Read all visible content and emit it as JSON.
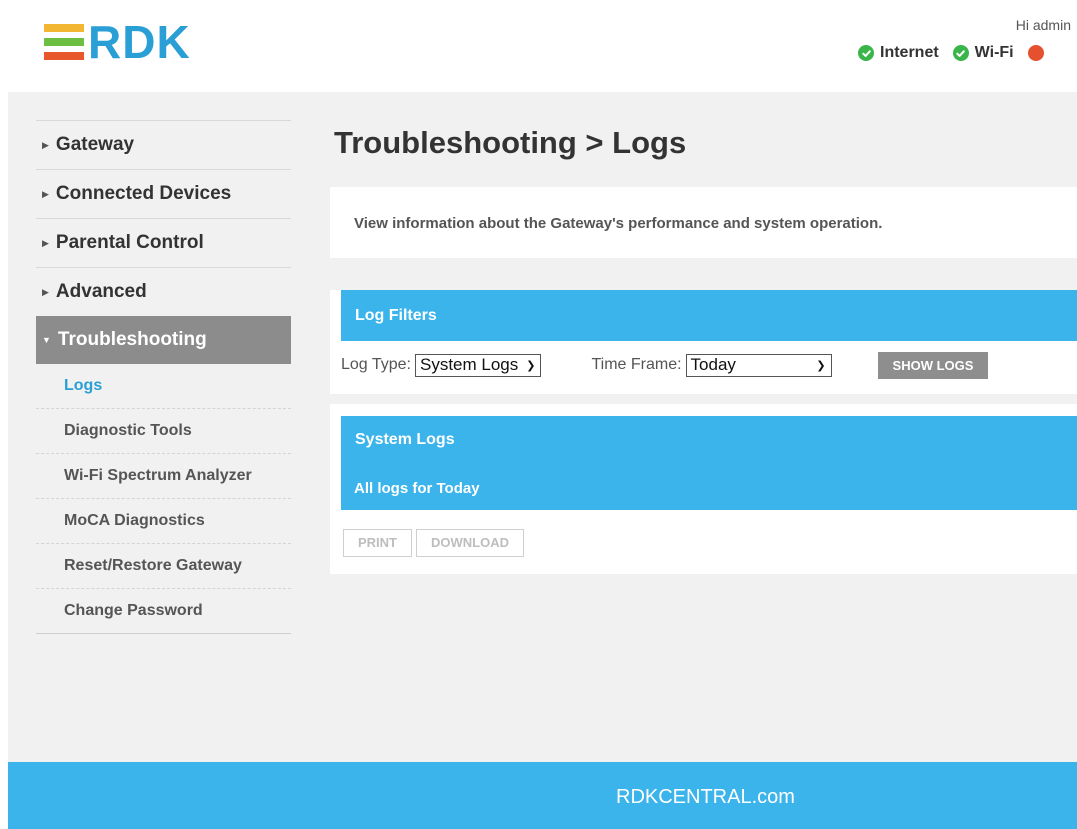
{
  "header": {
    "logo_text": "RDK",
    "logo_colors": [
      "#f2b632",
      "#6cbf43",
      "#e8582a"
    ],
    "brand_color": "#2a9fd6",
    "greeting": "Hi admin",
    "status": [
      {
        "label": "Internet",
        "state": "ok",
        "icon": "check-circle-icon"
      },
      {
        "label": "Wi-Fi",
        "state": "ok",
        "icon": "check-circle-icon"
      }
    ]
  },
  "sidebar": {
    "items": [
      {
        "label": "Gateway"
      },
      {
        "label": "Connected Devices"
      },
      {
        "label": "Parental Control"
      },
      {
        "label": "Advanced"
      },
      {
        "label": "Troubleshooting"
      }
    ],
    "subitems": [
      {
        "label": "Logs"
      },
      {
        "label": "Diagnostic Tools"
      },
      {
        "label": "Wi-Fi Spectrum Analyzer"
      },
      {
        "label": "MoCA Diagnostics"
      },
      {
        "label": "Reset/Restore Gateway"
      },
      {
        "label": "Change Password"
      }
    ]
  },
  "main": {
    "title": "Troubleshooting > Logs",
    "description": "View information about the Gateway's performance and system operation.",
    "filters": {
      "heading": "Log Filters",
      "log_type_label": "Log Type:",
      "log_type_value": "System Logs",
      "time_frame_label": "Time Frame:",
      "time_frame_value": "Today",
      "show_button": "SHOW LOGS"
    },
    "logs": {
      "heading": "System Logs",
      "subheading": "All logs for Today",
      "print_button": "PRINT",
      "download_button": "DOWNLOAD"
    }
  },
  "footer": {
    "link": "RDKCENTRAL.com"
  },
  "colors": {
    "accent": "#3ab4ea",
    "ok": "#39b54a",
    "error": "#e5502f"
  }
}
